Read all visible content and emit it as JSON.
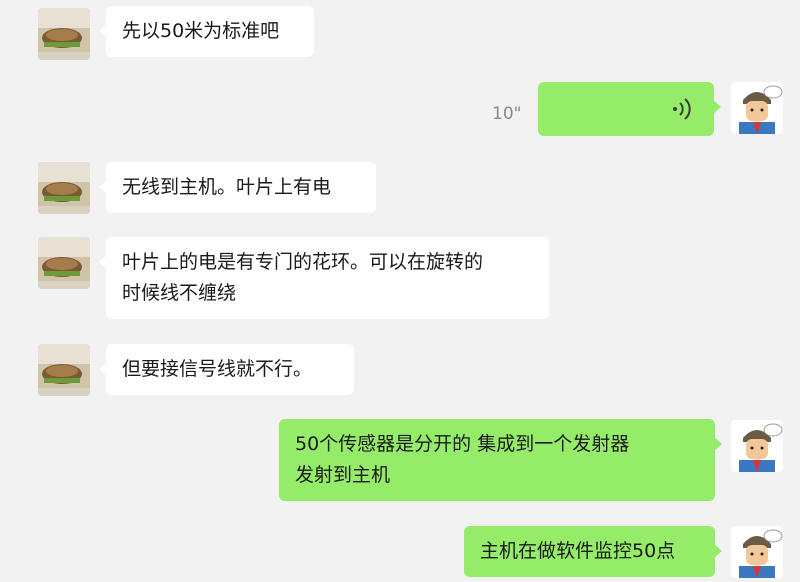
{
  "messages": [
    {
      "side": "in",
      "text": "先以50米为标准吧"
    },
    {
      "side": "out",
      "type": "voice",
      "duration": "10\""
    },
    {
      "side": "in",
      "text": "无线到主机。叶片上有电"
    },
    {
      "side": "in",
      "lines": [
        "叶片上的电是有专门的花环。可以在旋转的",
        "时候线不缠绕"
      ]
    },
    {
      "side": "in",
      "text": "但要接信号线就不行。"
    },
    {
      "side": "out",
      "lines": [
        "50个传感器是分开的 集成到一个发射器",
        "发射到主机"
      ]
    },
    {
      "side": "out",
      "text": "主机在做软件监控50点"
    }
  ],
  "colors": {
    "background": "#f2f2f2",
    "incoming_bubble": "#ffffff",
    "outgoing_bubble": "#95ec69",
    "duration_text": "#8a8a8a"
  },
  "icons": {
    "voice": "voice-wave-icon",
    "contact_avatar": "food-photo-avatar",
    "self_avatar": "cartoon-boy-avatar"
  }
}
